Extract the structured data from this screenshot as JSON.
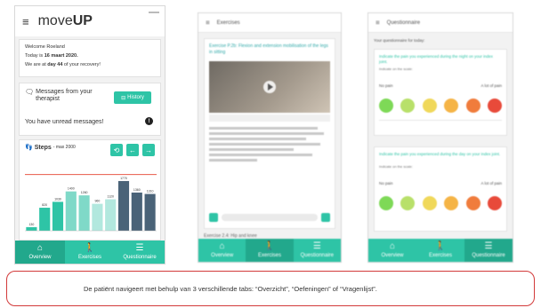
{
  "colors": {
    "accent": "#2ec4a6",
    "accent_dark": "#22a88c",
    "caption_border": "#d23a3a"
  },
  "phone1": {
    "logo_light": "move",
    "logo_bold": "UP",
    "welcome": {
      "greeting": "Welcome Roeland",
      "today_prefix": "Today is ",
      "today_date": "16 maart 2020.",
      "recovery_prefix": "We are at ",
      "recovery_day": "day 44",
      "recovery_suffix": " of your recovery!"
    },
    "messages": {
      "title": "Messages from your therapist",
      "history_label": "History",
      "unread_text": "You have unread messages!",
      "unread_icon": "!"
    },
    "steps": {
      "title": "Steps",
      "subtitle": "- max 2000"
    },
    "tabs": [
      {
        "label": "Overview",
        "icon": "home-icon",
        "glyph": "⌂"
      },
      {
        "label": "Exercises",
        "icon": "walk-icon",
        "glyph": "🚶"
      },
      {
        "label": "Questionnaire",
        "icon": "list-icon",
        "glyph": "☰"
      }
    ]
  },
  "chart_data": {
    "type": "bar",
    "categories": [
      "",
      "",
      "",
      "",
      "",
      "",
      "",
      "",
      "",
      ""
    ],
    "values": [
      130,
      820,
      1030,
      1400,
      1260,
      960,
      1120,
      1770,
      1360,
      1310
    ],
    "data_labels": [
      "130",
      "820",
      "1030",
      "1400",
      "1260",
      "960",
      "1120",
      "1770",
      "1360",
      "1310"
    ],
    "colors": [
      "#2ec4a6",
      "#2ec4a6",
      "#2ec4a6",
      "#7fd9c8",
      "#7fd9c8",
      "#b2e8de",
      "#b2e8de",
      "#4a6378",
      "#4a6378",
      "#4a6378"
    ],
    "goal_line": 2000,
    "ylim": [
      0,
      2400
    ],
    "title": "Steps",
    "xlabel": "",
    "ylabel": ""
  },
  "phone2": {
    "header_title": "Exercises",
    "exercise_title": "Exercise P.2b: Flexion and extension mobilisation of the legs in sitting",
    "next_title": "Exercise 2.4: Hip and knee",
    "tabs": [
      {
        "label": "Overview"
      },
      {
        "label": "Exercises"
      },
      {
        "label": "Questionnaire"
      }
    ]
  },
  "phone3": {
    "header_title": "Questionnaire",
    "intro": "Your questionnaire for today:",
    "questions": [
      {
        "text": "Indicate the pain you experienced during the night on your index joint.",
        "sub": "Indicate on the scale:",
        "left": "No pain",
        "right": "A lot of pain"
      },
      {
        "text": "Indicate the pain you experienced during the day on your index joint.",
        "sub": "Indicate on the scale:",
        "left": "No pain",
        "right": "A lot of pain"
      }
    ],
    "face_colors": [
      "#7ed957",
      "#b8e06a",
      "#f0d85a",
      "#f5b446",
      "#f07c3c",
      "#e84a3a"
    ],
    "tabs": [
      {
        "label": "Overview"
      },
      {
        "label": "Exercises"
      },
      {
        "label": "Questionnaire"
      }
    ]
  },
  "caption": "De patiënt navigeert met behulp van 3 verschillende tabs: “Overzicht”, “Oefeningen” of “Vragenlijst”."
}
